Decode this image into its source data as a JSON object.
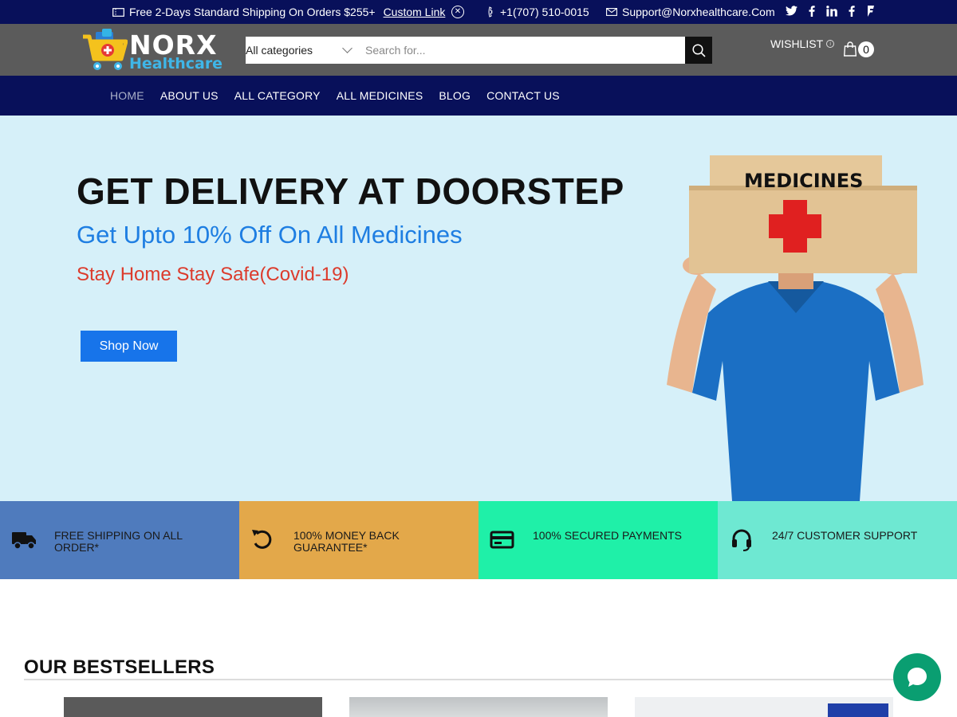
{
  "topbar": {
    "shipping_text": "Free 2-Days Standard Shipping On Orders $255+",
    "custom_link": "Custom Link",
    "phone": "+1(707) 510-0015",
    "email": "Support@Norxhealthcare.Com",
    "social": [
      "twitter",
      "facebook",
      "linkedin",
      "facebook",
      "foursquare"
    ]
  },
  "header": {
    "logo_line1": "NORX",
    "logo_line2": "Healthcare",
    "category_select": "All categories",
    "search_placeholder": "Search for...",
    "wishlist_label": "WISHLIST",
    "cart_count": "0"
  },
  "nav": {
    "items": [
      {
        "label": "HOME",
        "active": true
      },
      {
        "label": "ABOUT US"
      },
      {
        "label": "ALL CATEGORY"
      },
      {
        "label": "ALL MEDICINES"
      },
      {
        "label": "BLOG"
      },
      {
        "label": "CONTACT US"
      }
    ]
  },
  "hero": {
    "headline": "GET DELIVERY AT DOORSTEP",
    "subheadline": "Get Upto 10% Off On All Medicines",
    "tagline": "Stay Home Stay Safe(Covid-19)",
    "cta": "Shop Now",
    "box_label": "MEDICINES"
  },
  "features": [
    {
      "label": "FREE SHIPPING ON ALL ORDER*",
      "icon": "truck-icon",
      "color": "#4f7bbd"
    },
    {
      "label": "100% MONEY BACK GUARANTEE*",
      "icon": "undo-icon",
      "color": "#e3a84a"
    },
    {
      "label": "100% SECURED PAYMENTS",
      "icon": "credit-card-icon",
      "color": "#1ff0a8"
    },
    {
      "label": "24/7 CUSTOMER SUPPORT",
      "icon": "headset-icon",
      "color": "#6ee8d2"
    }
  ],
  "bestsellers": {
    "title": "OUR BESTSELLERS"
  },
  "colors": {
    "brand_navy": "#08105a",
    "header_gray": "#5b5b5b",
    "hero_bg": "#d6f0f9",
    "accent_blue": "#1774ea",
    "chat_green": "#0a9e71"
  }
}
